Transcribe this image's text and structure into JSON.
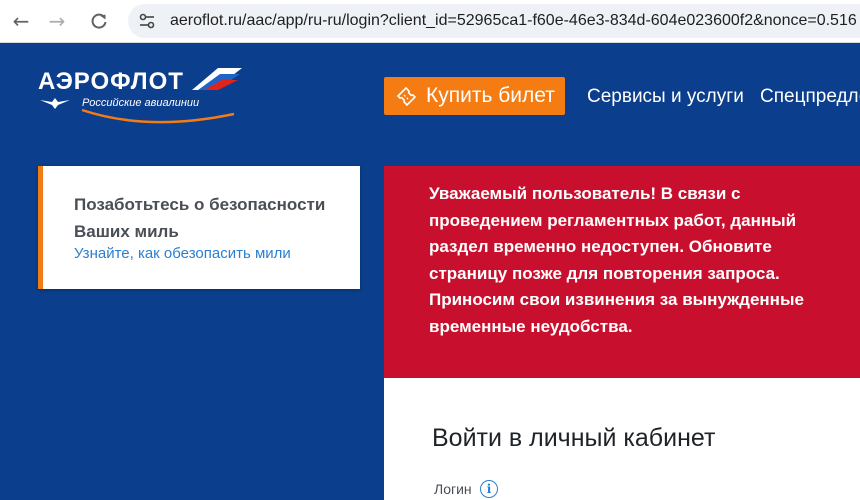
{
  "browser": {
    "url": "aeroflot.ru/aac/app/ru-ru/login?client_id=52965ca1-f60e-46e3-834d-604e023600f2&nonce=0.516",
    "icons": {
      "back": "back-arrow-icon",
      "forward": "forward-arrow-icon",
      "reload": "reload-icon",
      "site_info": "tune-icon"
    }
  },
  "header": {
    "logo_text": "АЭРОФЛОТ",
    "logo_subtitle": "Российские авиалинии",
    "buy_button": "Купить билет",
    "nav": [
      "Сервисы и услуги",
      "Спецпредло"
    ]
  },
  "info_card": {
    "title": "Позаботьтесь о безопасности Ваших миль",
    "link": "Узнайте, как обезопасить мили"
  },
  "alert": {
    "message": "Уважаемый пользователь! В связи с проведением регламентных работ, данный раздел временно недоступен. Обновите страницу позже для повторения запроса. Приносим свои извинения за вынужденные временные неудобства."
  },
  "login": {
    "title": "Войти в личный кабинет",
    "login_label": "Логин"
  },
  "colors": {
    "page_bg": "#0b3e8c",
    "accent_orange": "#f57c12",
    "alert_red": "#c8102e",
    "link_blue": "#2b7fd0"
  }
}
